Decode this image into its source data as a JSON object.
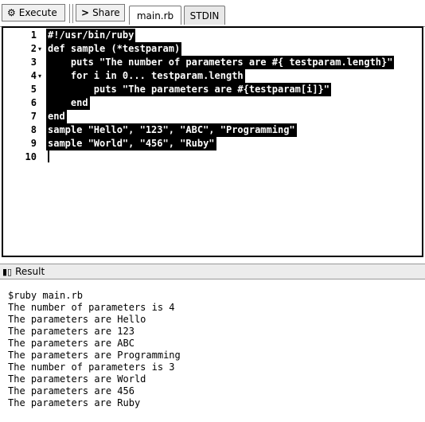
{
  "toolbar": {
    "execute_label": "Execute",
    "share_label": "Share",
    "tabs": [
      {
        "label": "main.rb",
        "active": true
      },
      {
        "label": "STDIN",
        "active": false
      }
    ]
  },
  "editor": {
    "lines": [
      {
        "num": "1",
        "code": "#!/usr/bin/ruby",
        "fold": ""
      },
      {
        "num": "2",
        "code": "def sample (*testparam)",
        "fold": "▾"
      },
      {
        "num": "3",
        "code": "    puts \"The number of parameters are #{ testparam.length}\"",
        "fold": ""
      },
      {
        "num": "4",
        "code": "    for i in 0... testparam.length",
        "fold": "▾"
      },
      {
        "num": "5",
        "code": "        puts \"The parameters are #{testparam[i]}\"",
        "fold": ""
      },
      {
        "num": "6",
        "code": "    end",
        "fold": ""
      },
      {
        "num": "7",
        "code": "end",
        "fold": ""
      },
      {
        "num": "8",
        "code": "sample \"Hello\", \"123\", \"ABC\", \"Programming\"",
        "fold": ""
      },
      {
        "num": "9",
        "code": "sample \"World\", \"456\", \"Ruby\"",
        "fold": ""
      },
      {
        "num": "10",
        "code": "",
        "fold": ""
      }
    ]
  },
  "result": {
    "label": "Result",
    "output": [
      "$ruby main.rb",
      "The number of parameters is 4",
      "The parameters are Hello",
      "The parameters are 123",
      "The parameters are ABC",
      "The parameters are Programming",
      "The number of parameters is 3",
      "The parameters are World",
      "The parameters are 456",
      "The parameters are Ruby"
    ]
  }
}
